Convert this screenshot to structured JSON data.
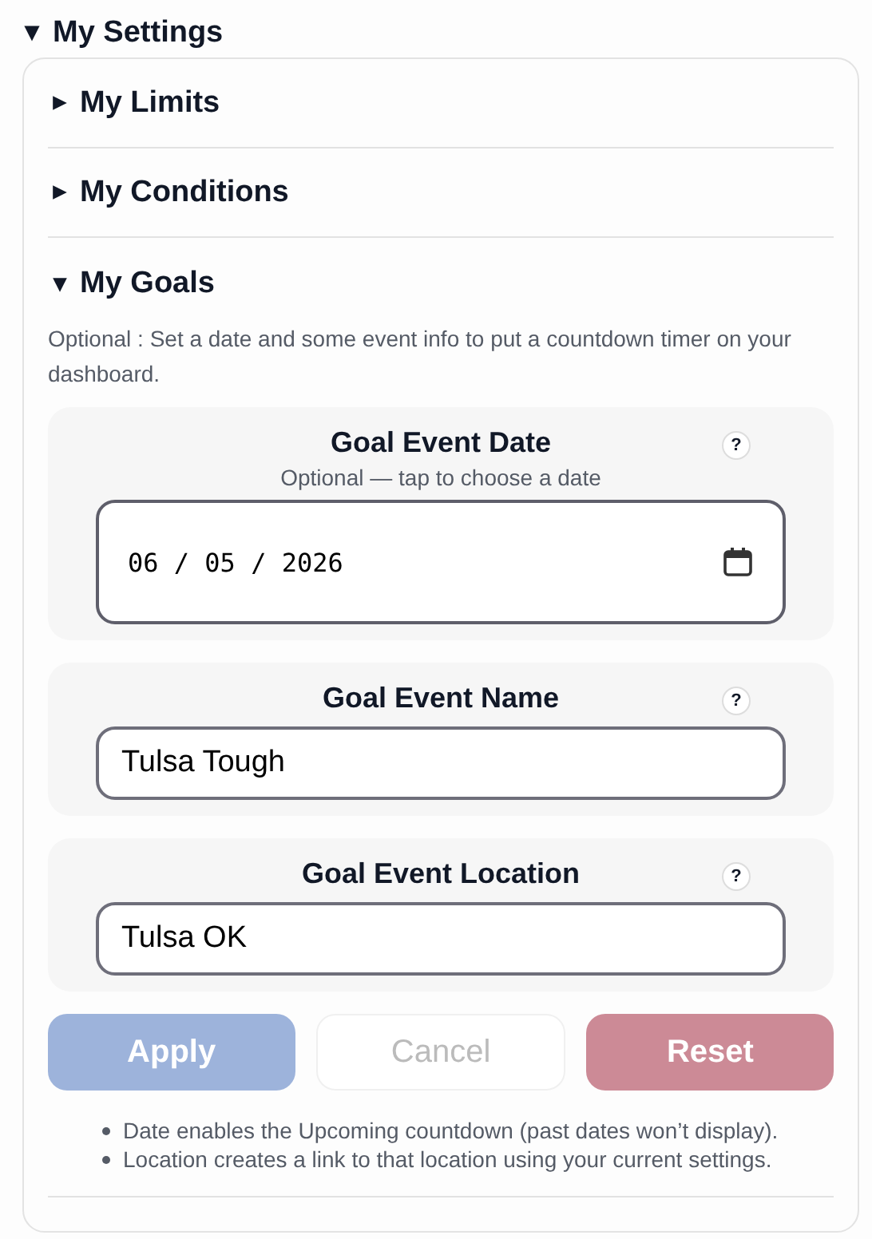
{
  "header": {
    "title": "My Settings",
    "expanded": true
  },
  "sections": [
    {
      "title": "My Limits",
      "expanded": false
    },
    {
      "title": "My Conditions",
      "expanded": false
    },
    {
      "title": "My Goals",
      "expanded": true,
      "description": "Optional : Set a date and some event info to put a countdown timer on your dashboard.",
      "fields": [
        {
          "kind": "date",
          "label": "Goal Event Date",
          "hint": "Optional — tap to choose a date",
          "help": "?",
          "value": "06 / 05 / 2026"
        },
        {
          "kind": "text",
          "label": "Goal Event Name",
          "help": "?",
          "value": "Tulsa Tough"
        },
        {
          "kind": "text",
          "label": "Goal Event Location",
          "help": "?",
          "value": "Tulsa OK"
        }
      ],
      "buttons": [
        {
          "label": "Apply",
          "kind": "primary",
          "disabled": true
        },
        {
          "label": "Cancel",
          "kind": "secondary",
          "disabled": true
        },
        {
          "label": "Reset",
          "kind": "danger",
          "disabled": true
        }
      ],
      "notes": [
        "Date enables the Upcoming countdown (past dates won’t display).",
        "Location creates a link to that location using your current settings."
      ]
    }
  ]
}
